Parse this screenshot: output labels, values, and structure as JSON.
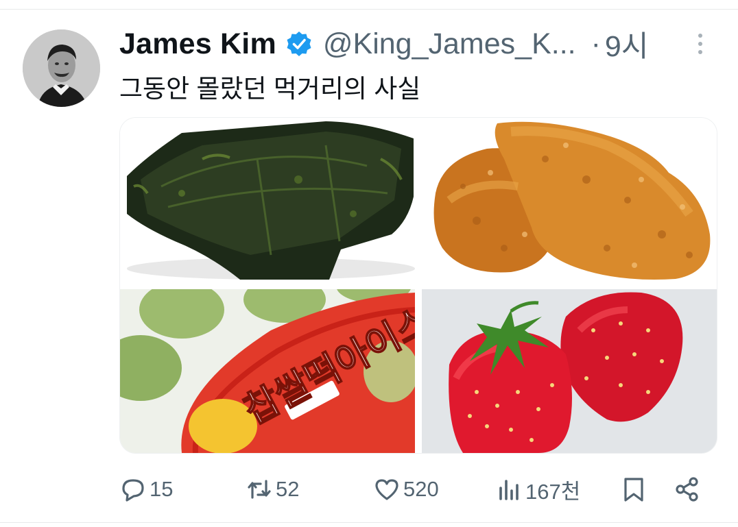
{
  "tweet": {
    "author": {
      "display_name": "James Kim",
      "handle": "@King_James_K...",
      "verified": true
    },
    "separator": "·",
    "time": "9시",
    "text": "그동안 몰랐던 먹거리의 사실",
    "media": [
      {
        "name": "seaweed-laver"
      },
      {
        "name": "fried-chicken"
      },
      {
        "name": "chapssaltteok-ice-cream",
        "label_text": "찹쌀떡아이스"
      },
      {
        "name": "strawberries"
      }
    ],
    "stats": {
      "replies": "15",
      "retweets": "52",
      "likes": "520",
      "views": "167천"
    },
    "icons": {
      "reply": "speech-bubble-icon",
      "retweet": "retweet-arrows-icon",
      "like": "heart-icon",
      "views": "bar-chart-icon",
      "bookmark": "bookmark-icon",
      "share": "share-icon",
      "more": "more-vertical-icon",
      "verified": "verified-badge-icon"
    },
    "colors": {
      "verified_blue": "#1d9bf0",
      "secondary_text": "#536471",
      "primary_text": "#0f1419"
    }
  }
}
